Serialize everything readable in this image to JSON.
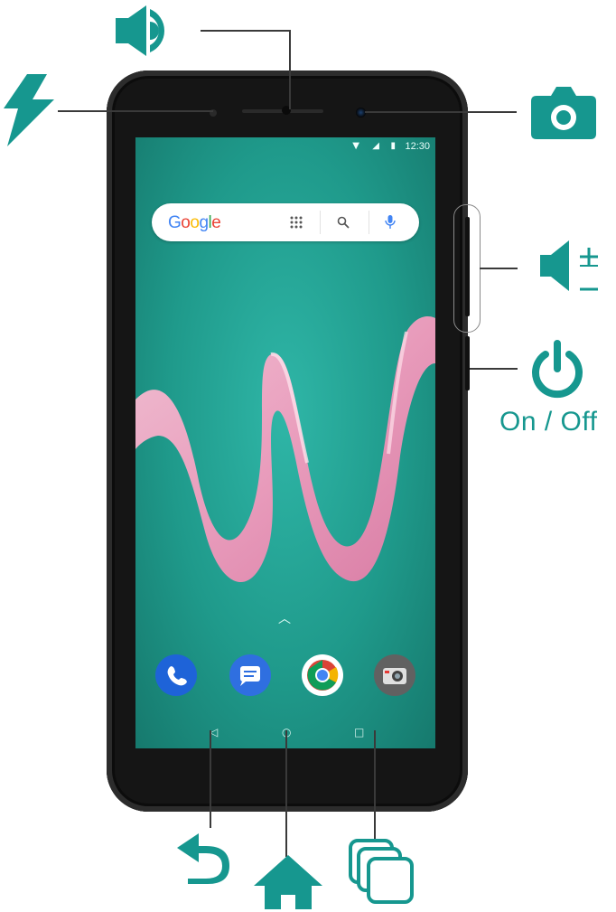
{
  "status_bar": {
    "time": "12:30"
  },
  "search_bar": {
    "logo_text": "Google"
  },
  "callouts": {
    "power_label": "On / Off"
  },
  "colors": {
    "accent": "#16978f",
    "screen": "#1f9a8b",
    "ribbon": "#f7a9c6"
  },
  "icons": [
    "speaker-icon",
    "flash-icon",
    "camera-icon",
    "volume-icon",
    "power-icon",
    "back-icon",
    "home-icon",
    "recents-icon",
    "phone-app-icon",
    "messages-app-icon",
    "chrome-app-icon",
    "camera-app-icon"
  ]
}
